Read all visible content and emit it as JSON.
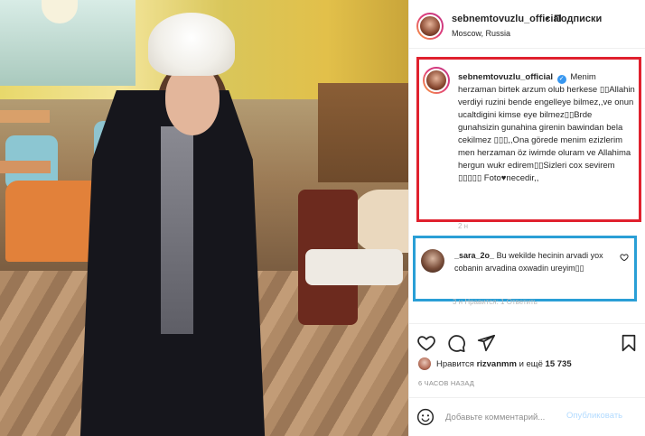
{
  "post": {
    "username": "sebnemtovuzlu_official",
    "separator": "•",
    "follow_label": "Подписки",
    "location": "Moscow, Russia"
  },
  "caption": {
    "username": "sebnemtovuzlu_official",
    "verified_mark": "✓",
    "text": "Menim herzaman birtek arzum olub herkese ▯▯Allahin verdiyi ruzini bende engelleye bilmez,,ve onun ucaltdigini kimse eye bilmez▯▯Brde gunahsizin gunahina girenin bawindan bela cekilmez ▯▯▯,,Ona görede menim ezizlerim men herzaman öz iwimde oluram ve Allahima hergun wukr edirem▯▯Sizleri cox sevirem ▯▯▯▯▯ Foto♥necedir,,",
    "faint_below": "2 н"
  },
  "comment": {
    "username": "_sara_2o_",
    "text": "Bu wekilde hecinin arvadi yox cobanin arvadina oxwadin ureyim▯▯",
    "faint_below": "3 н   Нравится: 1   Ответить"
  },
  "actions": {
    "like_icon": "heart-outline-icon",
    "comment_icon": "comment-bubble-icon",
    "share_icon": "paper-plane-icon",
    "save_icon": "bookmark-icon"
  },
  "likes": {
    "prefix": "Нравится",
    "user": "rizvanmm",
    "middle": "и ещё",
    "count": "15 735"
  },
  "timestamp": "6 ЧАСОВ НАЗАД",
  "add_comment": {
    "placeholder": "Добавьте комментарий...",
    "publish_label": "Опубликовать"
  },
  "colors": {
    "caption_highlight": "#e0212e",
    "comment_highlight": "#2a9fd6",
    "verified": "#3897f0",
    "publish_disabled": "#b3dbff"
  }
}
